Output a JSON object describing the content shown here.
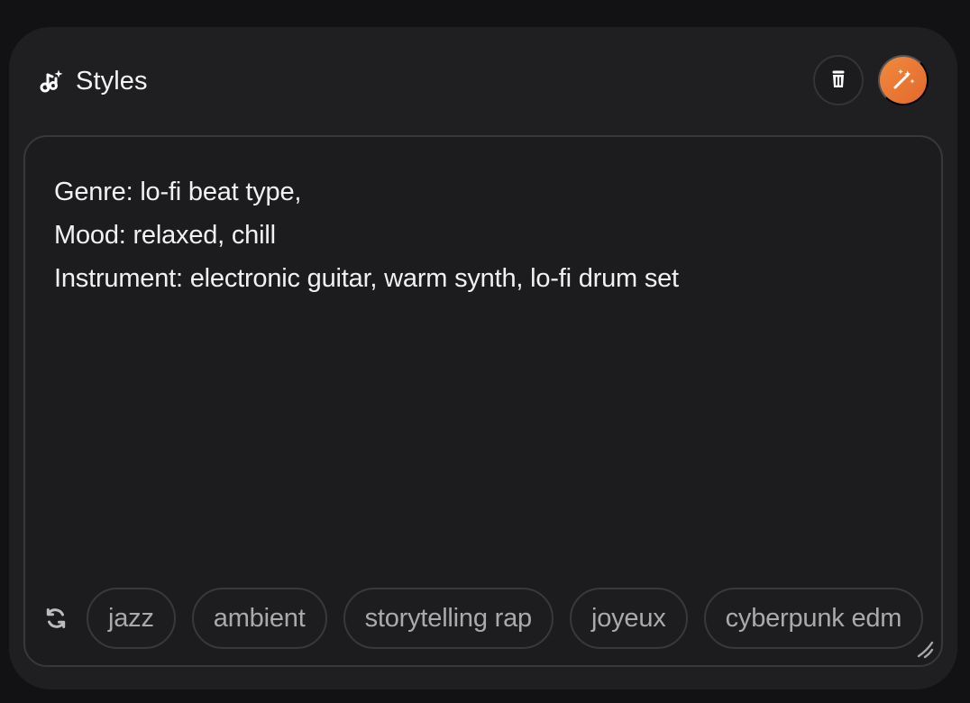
{
  "panel": {
    "title": "Styles",
    "title_icon": "music-note-sparkle-icon",
    "actions": {
      "delete_icon": "trash-icon",
      "magic_icon": "magic-wand-icon",
      "accent_color": "#E8732F"
    }
  },
  "editor": {
    "lines": [
      "Genre: lo-fi beat type,",
      "Mood: relaxed, chill",
      "Instrument: electronic guitar, warm synth, lo-fi drum set"
    ],
    "refresh_icon": "refresh-icon",
    "resize_icon": "resize-handle-icon"
  },
  "suggestions": [
    "jazz",
    "ambient",
    "storytelling rap",
    "joyeux",
    "cyberpunk edm"
  ]
}
